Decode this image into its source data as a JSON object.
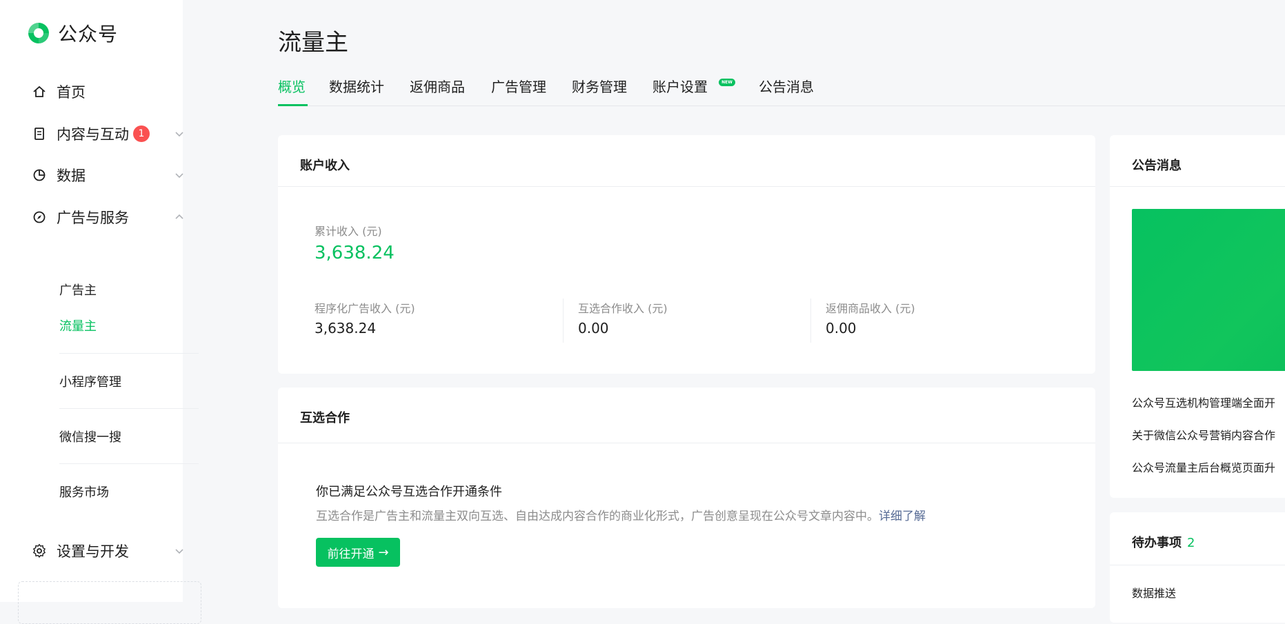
{
  "brand": {
    "name": "公众号"
  },
  "sidebar": {
    "items": [
      {
        "label": "首页",
        "icon": "home-icon"
      },
      {
        "label": "内容与互动",
        "icon": "document-icon",
        "badge": "1"
      },
      {
        "label": "数据",
        "icon": "pie-chart-icon"
      },
      {
        "label": "广告与服务",
        "icon": "compass-icon"
      },
      {
        "label": "设置与开发",
        "icon": "gear-icon"
      }
    ],
    "ad_sub_items": [
      "广告主",
      "流量主",
      "小程序管理",
      "微信搜一搜",
      "服务市场"
    ],
    "active_sub_item": "流量主"
  },
  "page": {
    "title": "流量主"
  },
  "tabs": [
    "概览",
    "数据统计",
    "返佣商品",
    "广告管理",
    "财务管理",
    "账户设置",
    "公告消息"
  ],
  "tab_new_tag": "NEW",
  "income": {
    "title": "账户收入",
    "total_label": "累计收入 (元)",
    "total_value": "3,638.24",
    "breakdown": [
      {
        "label": "程序化广告收入 (元)",
        "value": "3,638.24"
      },
      {
        "label": "互选合作收入 (元)",
        "value": "0.00"
      },
      {
        "label": "返佣商品收入 (元)",
        "value": "0.00"
      }
    ]
  },
  "cooperation": {
    "title": "互选合作",
    "heading": "你已满足公众号互选合作开通条件",
    "description": "互选合作是广告主和流量主双向互选、自由达成内容合作的商业化形式，广告创意呈现在公众号文章内容中。",
    "link": "详细了解",
    "button": "前往开通"
  },
  "announcements": {
    "title": "公告消息",
    "items": [
      "公众号互选机构管理端全面开",
      "关于微信公众号营销内容合作",
      "公众号流量主后台概览页面升"
    ]
  },
  "todo": {
    "title": "待办事项",
    "count": "2",
    "first_item": "数据推送"
  },
  "colors": {
    "accent": "#07c160",
    "badge": "#fa5151",
    "link": "#576b95"
  }
}
